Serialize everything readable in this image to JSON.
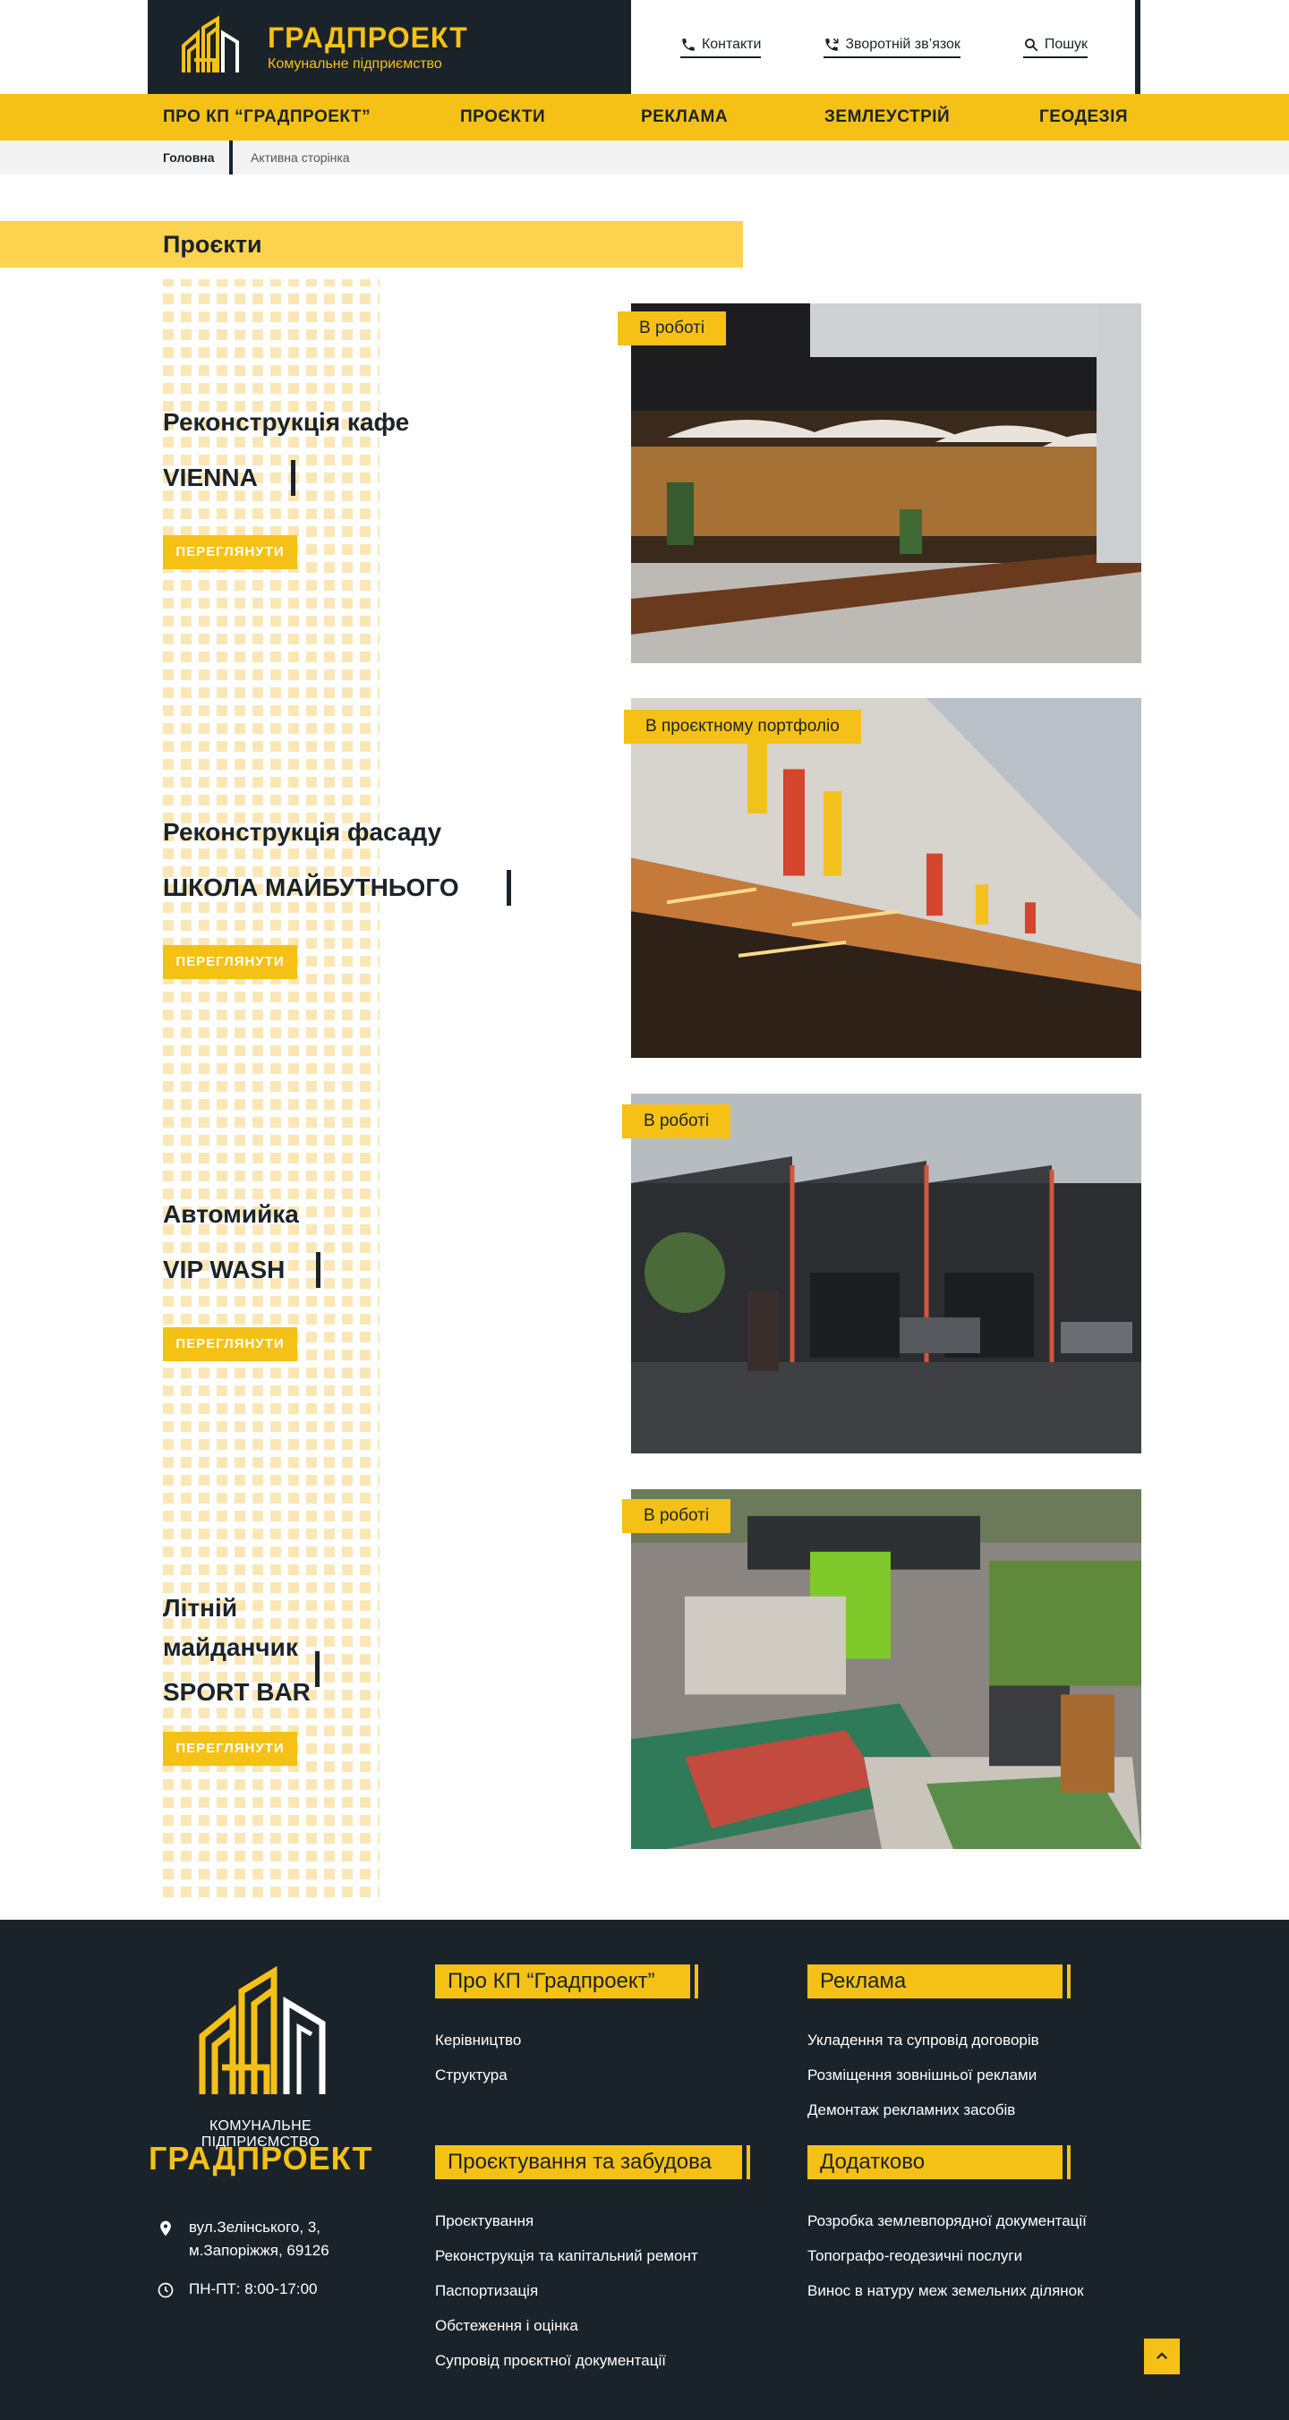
{
  "header": {
    "brand_name": "ГРАДПРОЕКТ",
    "brand_sub": "Комунальне підприємство",
    "contacts_label": "Контакти",
    "callback_label": "Зворотній зв’язок",
    "search_label": "Пошук"
  },
  "nav": {
    "items": [
      "ПРО КП “ГРАДПРОЕКТ”",
      "ПРОЄКТИ",
      "РЕКЛАМА",
      "ЗЕМЛЕУСТРІЙ",
      "ГЕОДЕЗІЯ"
    ]
  },
  "breadcrumbs": {
    "home": "Головна",
    "active": "Активна сторінка"
  },
  "section_title": "Проєкти",
  "projects": [
    {
      "title": "Реконструкція кафе",
      "name": "VIENNA",
      "button": "ПЕРЕГЛЯНУТИ",
      "status": "В роботі"
    },
    {
      "title": "Реконструкція фасаду",
      "name": "ШКОЛА МАЙБУТНЬОГО",
      "button": "ПЕРЕГЛЯНУТИ",
      "status": "В проєктному портфоліо"
    },
    {
      "title": "Автомийка",
      "name": "VIP WASH",
      "button": "ПЕРЕГЛЯНУТИ",
      "status": "В роботі"
    },
    {
      "title_line1": "Літній",
      "title_line2": "майданчик",
      "name": "SPORT BAR",
      "button": "ПЕРЕГЛЯНУТИ",
      "status": "В роботі"
    }
  ],
  "footer": {
    "caption": "КОМУНАЛЬНЕ ПІДПРИЄМСТВО",
    "name": "ГРАДПРОЕКТ",
    "address_line1": "вул.Зелінського, 3,",
    "address_line2": "м.Запоріжжя, 69126",
    "hours": "ПН-ПТ: 8:00-17:00",
    "col_about": {
      "title": "Про КП “Градпроект”",
      "links": [
        "Керівництво",
        "Структура"
      ]
    },
    "col_ads": {
      "title": "Реклама",
      "links": [
        "Укладення та супровід договорів",
        "Розміщення зовнішньої реклами",
        "Демонтаж рекламних засобів"
      ]
    },
    "col_design": {
      "title": "Проєктування та забудова",
      "links": [
        "Проєктування",
        "Реконструкція та капітальний ремонт",
        "Паспортизація",
        "Обстеження і оцінка",
        "Супровід проєктної документації"
      ]
    },
    "col_extra": {
      "title": "Додатково",
      "links": [
        "Розробка землевпорядної документації",
        "Топографо-геодезичні послуги",
        "Винос в натуру меж земельних ділянок"
      ]
    }
  },
  "colors": {
    "accent": "#f5c116",
    "dark": "#1b232a",
    "light_accent": "#fcd34f"
  }
}
